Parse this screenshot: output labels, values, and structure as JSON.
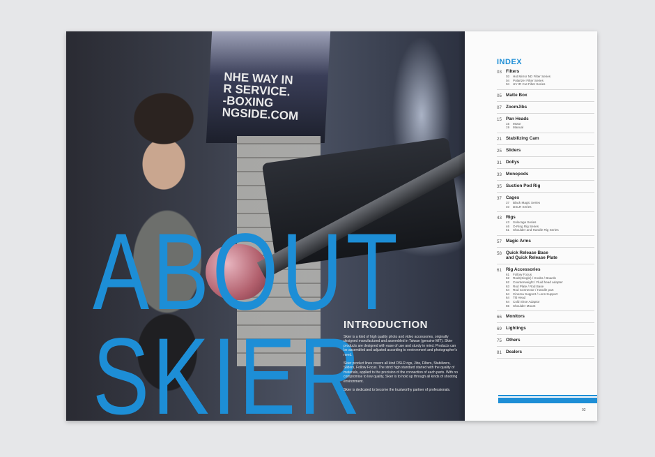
{
  "photo_page": {
    "headline_line1": "ABOUT",
    "headline_line2": "SKIER",
    "banner_text": "NHE WAY IN\nR SERVICE.\n-BOXING\nNGSIDE.COM",
    "intro_title": "INTRODUCTION",
    "intro_paragraphs": [
      "Skier is a kind of high quality photo and video accessories, originally designed manufactured and assembled in Taiwan (genuine MIT). Skier products are designed with ease of use and sturdy in mind. Products can be assembled and adjusted according to environment and photographer's need.",
      "Skier product lines covers all kind DSLR rigs, Jibs, Filters, Stabilizers, Sliders, Follow Focus. The strict high standard started with the quality of materials, applied to the precision of the connection of each parts. With no compromise to low quality, Skier is to hold up through all kinds of shooting environment.",
      "Skier is dedicated to become the trustworthy partner of professionals."
    ]
  },
  "index_page": {
    "title": "INDEX",
    "items": [
      {
        "num": "03",
        "label": "Filters",
        "subs": [
          [
            "03",
            "Hot Mirror ND Filter Series"
          ],
          [
            "04",
            "Polarizer Filter Series"
          ],
          [
            "04",
            "UV IR Cut Filter Series"
          ]
        ]
      },
      {
        "num": "05",
        "label": "Matte Box",
        "subs": []
      },
      {
        "num": "07",
        "label": "ZoomJibs",
        "subs": []
      },
      {
        "num": "15",
        "label": "Pan Heads",
        "subs": [
          [
            "15",
            "Motor"
          ],
          [
            "19",
            "Manual"
          ]
        ]
      },
      {
        "num": "21",
        "label": "Stabilizing Cam",
        "subs": []
      },
      {
        "num": "25",
        "label": "Sliders",
        "subs": []
      },
      {
        "num": "31",
        "label": "Dollys",
        "subs": []
      },
      {
        "num": "33",
        "label": "Monopods",
        "subs": []
      },
      {
        "num": "35",
        "label": "Suction Pod Rig",
        "subs": []
      },
      {
        "num": "37",
        "label": "Cages",
        "subs": [
          [
            "37",
            "Black Magic Series"
          ],
          [
            "40",
            "DSLR Series"
          ]
        ]
      },
      {
        "num": "43",
        "label": "Rigs",
        "subs": [
          [
            "43",
            "Solocage Series"
          ],
          [
            "46",
            "O-Ring Rig Series"
          ],
          [
            "51",
            "Shoulder and Handle Rig Series"
          ]
        ]
      },
      {
        "num": "57",
        "label": "Magic Arms",
        "subs": []
      },
      {
        "num": "58",
        "label": "Quick Release Base\nand Quick Release Plate",
        "subs": []
      },
      {
        "num": "61",
        "label": "Rig Accessories",
        "subs": [
          [
            "61",
            "Follow Focus"
          ],
          [
            "62",
            "Rods(Single) / Knobs / Boards"
          ],
          [
            "62",
            "Counterweight / Fluid head adapter"
          ],
          [
            "63",
            "Rod Plate / Rod Base"
          ],
          [
            "64",
            "Rod Connector / Handle part"
          ],
          [
            "64",
            "Cinema Support / Lens Support"
          ],
          [
            "64",
            "Tilt Head"
          ],
          [
            "64",
            "Cold Shoe Adaptor"
          ],
          [
            "65",
            "Shoulder Mount"
          ]
        ]
      },
      {
        "num": "66",
        "label": "Monitors",
        "subs": []
      },
      {
        "num": "69",
        "label": "Lightings",
        "subs": []
      },
      {
        "num": "75",
        "label": "Others",
        "subs": []
      },
      {
        "num": "81",
        "label": "Dealers",
        "subs": []
      }
    ],
    "page_number": "02"
  },
  "colors": {
    "accent_blue": "#1d8ed6",
    "background": "#e6e7e9"
  }
}
